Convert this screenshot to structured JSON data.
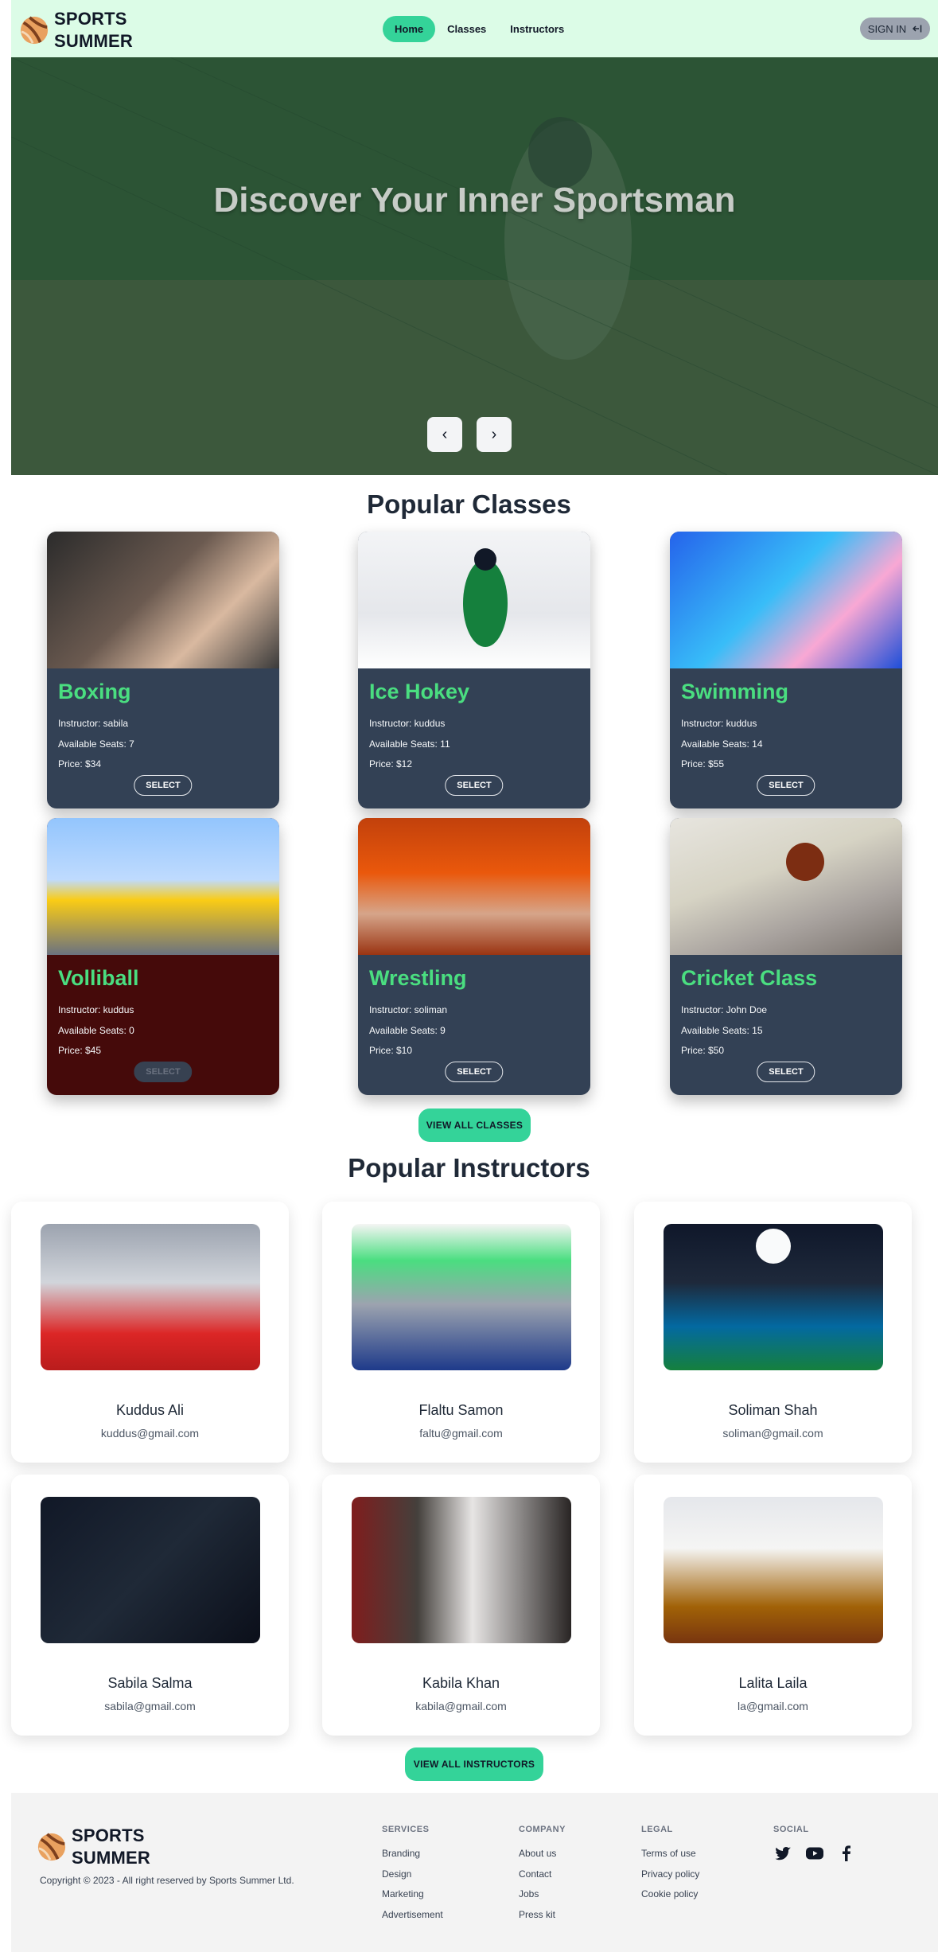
{
  "brand": {
    "line1": "SPORTS",
    "line2": "SUMMER"
  },
  "nav": {
    "items": [
      {
        "label": "Home",
        "active": true
      },
      {
        "label": "Classes",
        "active": false
      },
      {
        "label": "Instructors",
        "active": false
      }
    ],
    "signin_label": "SIGN IN",
    "signin_icon": "login-arrow-icon"
  },
  "hero": {
    "title": "Discover Your Inner Sportsman",
    "prev_label": "‹",
    "next_label": "›"
  },
  "popular_classes": {
    "title": "Popular Classes",
    "items": [
      {
        "name": "Boxing",
        "instructor": "Instructor: sabila",
        "seats": "Available Seats: 7",
        "price": "Price: $34",
        "button": "SELECT",
        "sold_out": false
      },
      {
        "name": "Ice Hokey",
        "instructor": "Instructor: kuddus",
        "seats": "Available Seats: 11",
        "price": "Price: $12",
        "button": "SELECT",
        "sold_out": false
      },
      {
        "name": "Swimming",
        "instructor": "Instructor: kuddus",
        "seats": "Available Seats: 14",
        "price": "Price: $55",
        "button": "SELECT",
        "sold_out": false
      },
      {
        "name": "Volliball",
        "instructor": "Instructor: kuddus",
        "seats": "Available Seats: 0",
        "price": "Price: $45",
        "button": "SELECT",
        "sold_out": true
      },
      {
        "name": "Wrestling",
        "instructor": "Instructor: soliman",
        "seats": "Available Seats: 9",
        "price": "Price: $10",
        "button": "SELECT",
        "sold_out": false
      },
      {
        "name": "Cricket Class",
        "instructor": "Instructor: John Doe",
        "seats": "Available Seats: 15",
        "price": "Price: $50",
        "button": "SELECT",
        "sold_out": false
      }
    ],
    "view_all_label": "VIEW ALL CLASSES"
  },
  "popular_instructors": {
    "title": "Popular Instructors",
    "items": [
      {
        "name": "Kuddus Ali",
        "email": "kuddus@gmail.com"
      },
      {
        "name": "Flaltu Samon",
        "email": "faltu@gmail.com"
      },
      {
        "name": "Soliman Shah",
        "email": "soliman@gmail.com"
      },
      {
        "name": "Sabila Salma",
        "email": "sabila@gmail.com"
      },
      {
        "name": "Kabila Khan",
        "email": "kabila@gmail.com"
      },
      {
        "name": "Lalita Laila",
        "email": "la@gmail.com"
      }
    ],
    "view_all_label": "VIEW ALL INSTRUCTORS"
  },
  "footer": {
    "brand": {
      "line1": "SPORTS",
      "line2": "SUMMER"
    },
    "copyright": "Copyright © 2023 - All right reserved by Sports Summer Ltd.",
    "columns": [
      {
        "heading": "SERVICES",
        "links": [
          "Branding",
          "Design",
          "Marketing",
          "Advertisement"
        ]
      },
      {
        "heading": "COMPANY",
        "links": [
          "About us",
          "Contact",
          "Jobs",
          "Press kit"
        ]
      },
      {
        "heading": "LEGAL",
        "links": [
          "Terms of use",
          "Privacy policy",
          "Cookie policy"
        ]
      }
    ],
    "social_heading": "SOCIAL",
    "social_icons": [
      "twitter-icon",
      "youtube-icon",
      "facebook-icon"
    ]
  },
  "colors": {
    "nav_bg": "#dcfce7",
    "accent": "#34d399",
    "card_bg": "#334155",
    "card_soldout_bg": "#450a0a",
    "class_name": "#4ade80"
  }
}
